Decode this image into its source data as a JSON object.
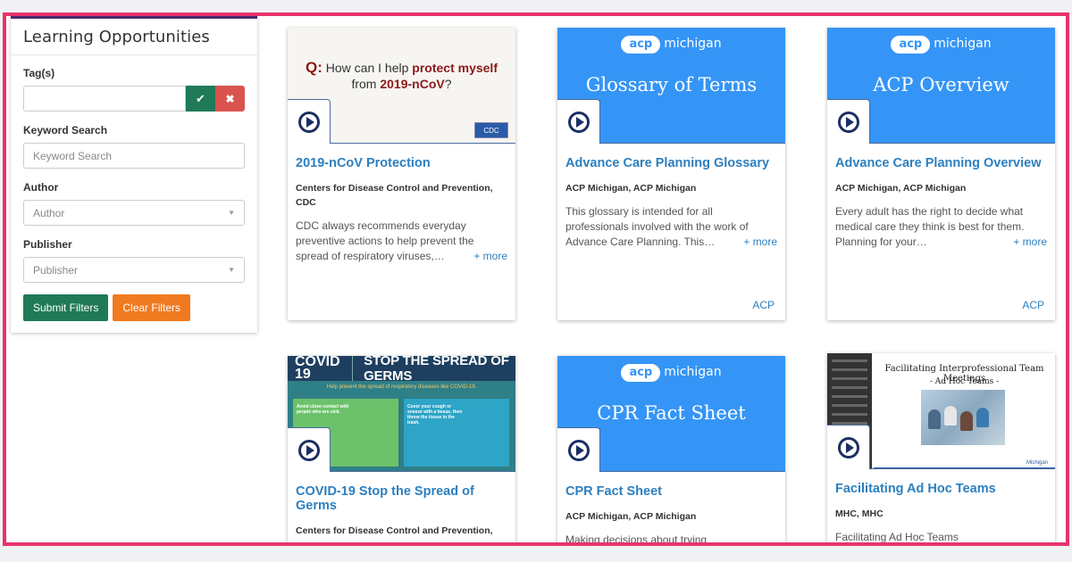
{
  "sidebar": {
    "title": "Learning Opportunities",
    "tags_label": "Tag(s)",
    "keyword_label": "Keyword Search",
    "keyword_placeholder": "Keyword Search",
    "author_label": "Author",
    "author_value": "Author",
    "publisher_label": "Publisher",
    "publisher_value": "Publisher",
    "submit_label": "Submit Filters",
    "clear_label": "Clear Filters",
    "confirm_icon": "✔",
    "clear_icon": "✖"
  },
  "cards": [
    {
      "title": "2019-nCoV Protection",
      "author": "Centers for Disease Control and Prevention, CDC",
      "desc": "CDC always recommends everyday preventive actions to help prevent the spread of respiratory viruses,…",
      "more": "+ more",
      "thumb_q": "Q:",
      "thumb_line1": "How can I help ",
      "thumb_bold": "protect myself",
      "thumb_line2": "from ",
      "thumb_bold2": "2019-nCoV",
      "thumb_q_end": "?",
      "badge": "CDC"
    },
    {
      "title": "Advance Care Planning Glossary",
      "author": "ACP Michigan, ACP Michigan",
      "desc": "This glossary is intended for all professionals involved with the work of Advance Care Planning. This…",
      "more": "+ more",
      "tag": "ACP",
      "logo_pill": "acp",
      "logo_text": "michigan",
      "thumb_title": "Glossary of Terms"
    },
    {
      "title": "Advance Care Planning Overview",
      "author": "ACP Michigan, ACP Michigan",
      "desc": "Every adult has the right to decide what medical care they think is best for them. Planning for your…",
      "more": "+ more",
      "tag": "ACP",
      "logo_pill": "acp",
      "logo_text": "michigan",
      "thumb_title": "ACP Overview"
    },
    {
      "title": "COVID-19 Stop the Spread of Germs",
      "author": "Centers for Disease Control and Prevention,",
      "thumb_big": "COVID 19",
      "thumb_head": "STOP THE SPREAD OF GERMS",
      "thumb_sub": "Help prevent the spread of respiratory diseases like COVID-19.",
      "thumb_left": "Avoid close contact with people who are sick.",
      "thumb_right": "Cover your cough or sneeze with a tissue, then throw the tissue in the trash."
    },
    {
      "title": "CPR Fact Sheet",
      "author": "ACP Michigan, ACP Michigan",
      "desc": "Making decisions about trying",
      "logo_pill": "acp",
      "logo_text": "michigan",
      "thumb_title": "CPR Fact Sheet"
    },
    {
      "title": "Facilitating Ad Hoc Teams",
      "author": "MHC, MHC",
      "desc": "Facilitating Ad Hoc Teams",
      "thumb_title": "Facilitating Interprofessional Team Meetings",
      "thumb_sub": "- Ad Hoc Teams -",
      "thumb_logo": "Michigan"
    }
  ],
  "colors": {
    "frame": "#e8336b",
    "acp_blue": "#3595f6",
    "title_blue": "#2c7fbf",
    "green": "#1f7a57",
    "orange": "#f07a1f",
    "red": "#d9534f"
  }
}
